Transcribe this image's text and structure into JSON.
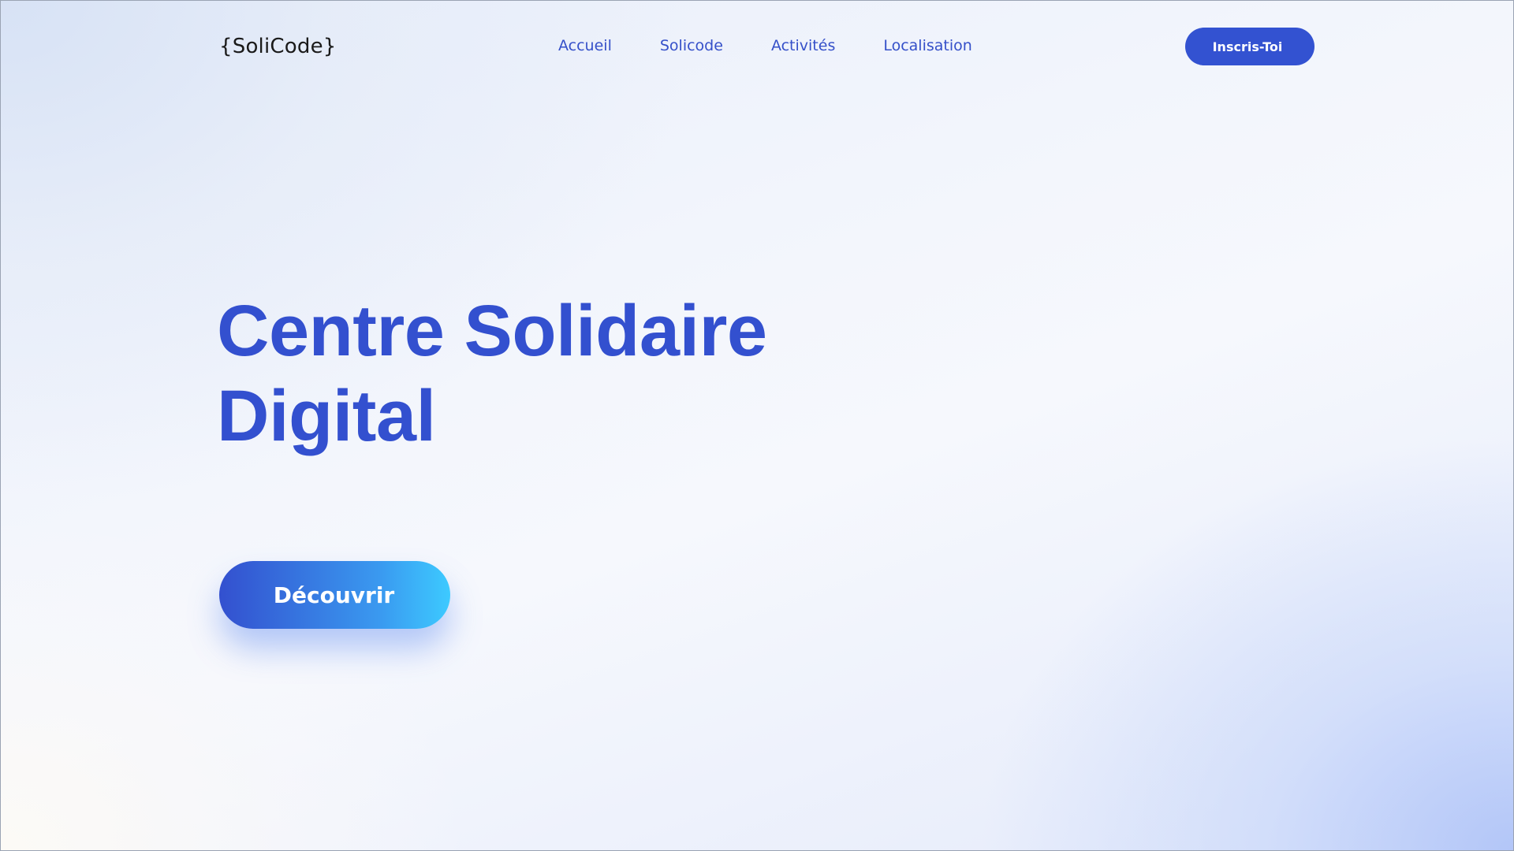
{
  "header": {
    "logo": "{SoliCode}",
    "nav": [
      {
        "label": "Accueil"
      },
      {
        "label": "Solicode"
      },
      {
        "label": "Activités"
      },
      {
        "label": "Localisation"
      }
    ],
    "signup_label": "Inscris-Toi"
  },
  "hero": {
    "title_line1": "Centre Solidaire",
    "title_line2": "Digital",
    "cta_label": "Découvrir"
  },
  "colors": {
    "accent": "#3350cf",
    "cta_gradient_end": "#3dcaff"
  }
}
